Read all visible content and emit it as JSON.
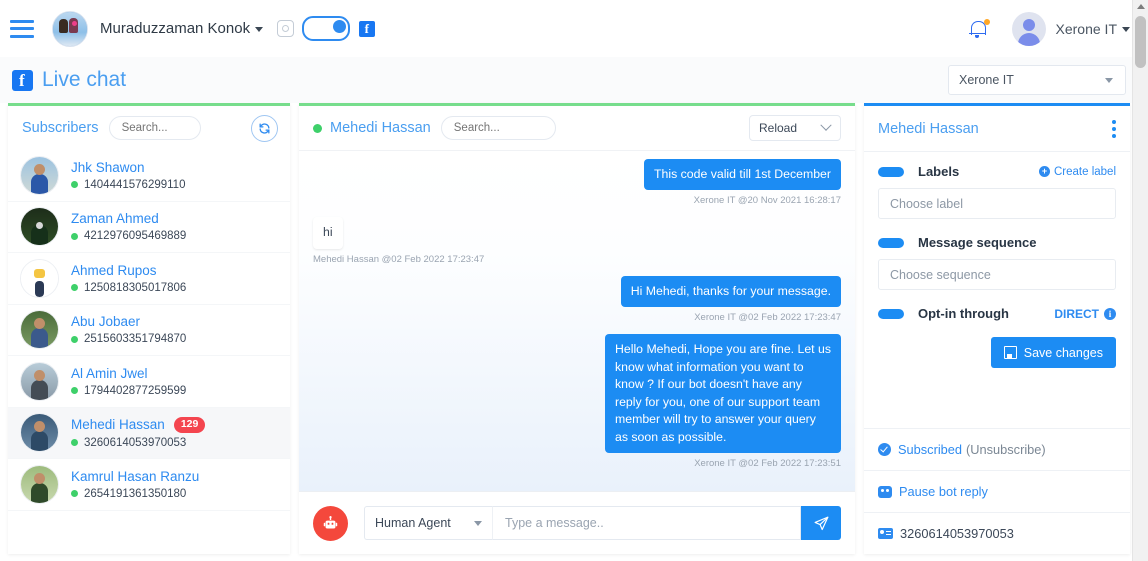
{
  "topbar": {
    "menu_icon": "hamburger-icon",
    "page_name": "Muraduzzaman Konok",
    "instagram_icon": "instagram-icon",
    "toggle_state": "on",
    "facebook_icon": "facebook-icon",
    "bell_icon": "notification-bell-icon",
    "user_name": "Xerone IT"
  },
  "subheader": {
    "title": "Live chat",
    "facebook_icon": "facebook-icon",
    "page_select_value": "Xerone IT"
  },
  "subscribers": {
    "label": "Subscribers",
    "search_placeholder": "Search...",
    "refresh_icon": "refresh-icon",
    "items": [
      {
        "name": "Jhk Shawon",
        "id": "1404441576299110",
        "status": "online",
        "badge": ""
      },
      {
        "name": "Zaman Ahmed",
        "id": "4212976095469889",
        "status": "online",
        "badge": ""
      },
      {
        "name": "Ahmed Rupos",
        "id": "1250818305017806",
        "status": "online",
        "badge": ""
      },
      {
        "name": "Abu Jobaer",
        "id": "2515603351794870",
        "status": "online",
        "badge": ""
      },
      {
        "name": "Al Amin Jwel",
        "id": "1794402877259599",
        "status": "online",
        "badge": ""
      },
      {
        "name": "Mehedi Hassan",
        "id": "3260614053970053",
        "status": "online",
        "badge": "129"
      },
      {
        "name": "Kamrul Hasan Ranzu",
        "id": "2654191361350180",
        "status": "online",
        "badge": ""
      }
    ]
  },
  "chat": {
    "peer_name": "Mehedi Hassan",
    "search_placeholder": "Search...",
    "reload_value": "Reload",
    "messages": [
      {
        "direction": "out",
        "text": "This code valid till 1st December",
        "stamp": "Xerone IT @20 Nov 2021 16:28:17"
      },
      {
        "direction": "in",
        "text": "hi",
        "stamp": "Mehedi Hassan @02 Feb 2022 17:23:47"
      },
      {
        "direction": "out",
        "text": "Hi Mehedi, thanks for your message.",
        "stamp": "Xerone IT @02 Feb 2022 17:23:47"
      },
      {
        "direction": "out",
        "text": "Hello Mehedi, Hope you are fine. Let us know what information you want to know ? If our bot doesn't have any reply for you, one of our support team member will try to answer your query as soon as possible.",
        "stamp": "Xerone IT @02 Feb 2022 17:23:51"
      }
    ],
    "composer": {
      "bot_icon": "robot-icon",
      "agent_select_value": "Human Agent",
      "input_placeholder": "Type a message..",
      "send_icon": "send-icon"
    }
  },
  "side": {
    "title": "Mehedi Hassan",
    "kebab_icon": "more-options-icon",
    "labels_row": {
      "label": "Labels",
      "create_label": "Create label",
      "plus_icon": "plus-circle-icon",
      "choose_placeholder": "Choose label"
    },
    "sequence_row": {
      "label": "Message sequence",
      "choose_placeholder": "Choose sequence"
    },
    "optin_row": {
      "label": "Opt-in through",
      "value": "DIRECT",
      "info_icon": "info-icon"
    },
    "save_button": "Save changes",
    "save_icon": "save-disk-icon",
    "subscribed": {
      "check_icon": "check-circle-icon",
      "text": "Subscribed",
      "action": "(Unsubscribe)"
    },
    "pause_bot": {
      "icon": "robot-icon",
      "text": "Pause bot reply"
    },
    "subscriber_id": {
      "icon": "id-card-icon",
      "text": "3260614053970053"
    }
  },
  "colors": {
    "accent_blue": "#1c8cf3",
    "link_blue": "#2e8bf0",
    "green_rule": "#77dd8c",
    "badge_red": "#f4454f",
    "bot_red": "#f4483c",
    "online_green": "#3ed06a"
  }
}
